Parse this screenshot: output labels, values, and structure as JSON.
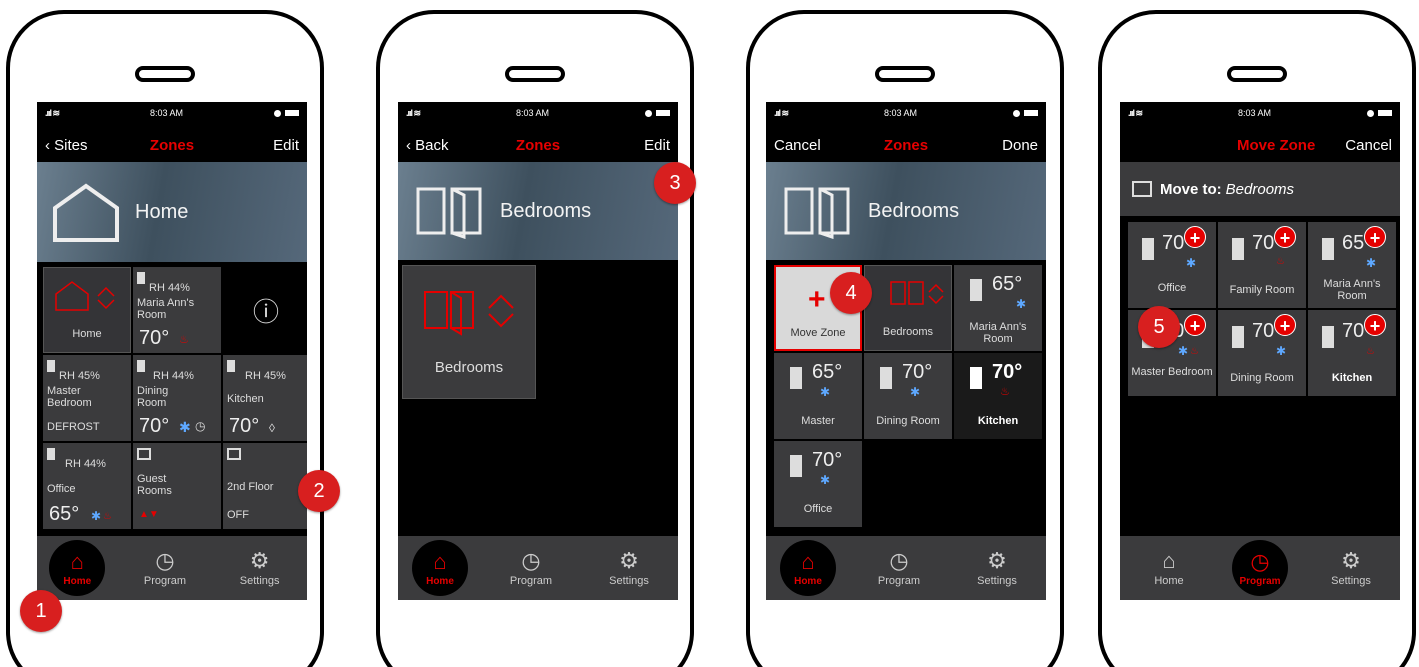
{
  "status": {
    "time": "8:03 AM"
  },
  "s1": {
    "left": "‹ Sites",
    "title": "Zones",
    "right": "Edit",
    "banner": "Home",
    "tiles": [
      {
        "name": "Home",
        "icon": "home-icon"
      },
      {
        "rh": "RH 44%",
        "name": "Maria Ann's Room",
        "temp": "70°"
      },
      {
        "info": "ⓘ"
      },
      {
        "rh": "RH 45%",
        "name": "Master Bedroom",
        "status": "DEFROST"
      },
      {
        "rh": "RH 44%",
        "name": "Dining Room",
        "temp": "70°"
      },
      {
        "rh": "RH 45%",
        "name": "Kitchen",
        "temp": "70°"
      },
      {
        "rh": "RH 44%",
        "name": "Office",
        "temp": "65°"
      },
      {
        "name": "Guest Rooms"
      },
      {
        "name": "2nd Floor",
        "status": "OFF"
      }
    ],
    "tabs": [
      "Home",
      "Program",
      "Settings"
    ]
  },
  "s2": {
    "left": "‹ Back",
    "title": "Zones",
    "right": "Edit",
    "banner": "Bedrooms",
    "tile": "Bedrooms",
    "tabs": [
      "Home",
      "Program",
      "Settings"
    ]
  },
  "s3": {
    "left": "Cancel",
    "title": "Zones",
    "right": "Done",
    "banner": "Bedrooms",
    "tiles": [
      {
        "name": "Move Zone"
      },
      {
        "name": "Bedrooms"
      },
      {
        "name": "Maria Ann's Room",
        "temp": "65°"
      },
      {
        "name": "Master",
        "temp": "65°"
      },
      {
        "name": "Dining Room",
        "temp": "70°"
      },
      {
        "name": "Kitchen",
        "temp": "70°"
      },
      {
        "name": "Office",
        "temp": "70°"
      }
    ],
    "tabs": [
      "Home",
      "Program",
      "Settings"
    ]
  },
  "s4": {
    "title": "Move Zone",
    "right": "Cancel",
    "move_to": "Move to:",
    "move_to_target": "Bedrooms",
    "tiles": [
      {
        "name": "Office",
        "temp": "70"
      },
      {
        "name": "Family Room",
        "temp": "70"
      },
      {
        "name": "Maria Ann's Room",
        "temp": "65"
      },
      {
        "name": "Master Bedroom",
        "temp": "70"
      },
      {
        "name": "Dining Room",
        "temp": "70"
      },
      {
        "name": "Kitchen",
        "temp": "70"
      }
    ],
    "tabs": [
      "Home",
      "Program",
      "Settings"
    ]
  },
  "badges": [
    "1",
    "2",
    "3",
    "4",
    "5"
  ]
}
